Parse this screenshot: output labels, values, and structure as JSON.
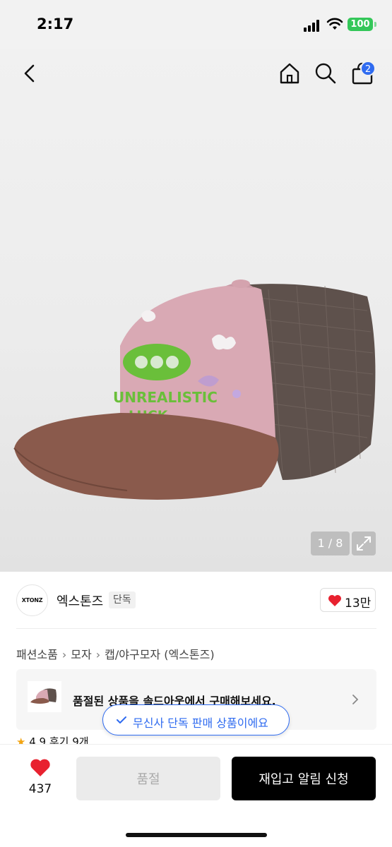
{
  "status_bar": {
    "time": "2:17",
    "battery": "100"
  },
  "header": {
    "cart_count": "2"
  },
  "gallery": {
    "counter": "1 / 8"
  },
  "brand": {
    "logo_text": "XTONZ",
    "name": "엑스톤즈",
    "tag": "단독",
    "likes": "13만"
  },
  "breadcrumb": [
    "패션소품",
    "모자",
    "캡/야구모자 (엑스톤즈)"
  ],
  "banner": {
    "text": "품절된 상품을 솔드아웃에서 구매해보세요."
  },
  "rating": {
    "score": "4.9",
    "reviews": "후기 9개"
  },
  "toast": {
    "text": "무신사 단독 판매 상품이에요"
  },
  "bottom": {
    "wish_count": "437",
    "soldout_label": "품절",
    "restock_label": "재입고 알림 신청"
  },
  "colors": {
    "accent": "#2f6bf0",
    "heart": "#e8212f",
    "cap_pink": "#d9a9b4",
    "cap_brown": "#8a5a4c",
    "mesh": "#5e514c",
    "embroidery": "#6abf3a"
  },
  "icons": [
    "back-arrow-icon",
    "home-icon",
    "search-icon",
    "cart-icon",
    "expand-icon",
    "heart-icon",
    "chevron-right-icon",
    "check-icon",
    "star-icon"
  ]
}
